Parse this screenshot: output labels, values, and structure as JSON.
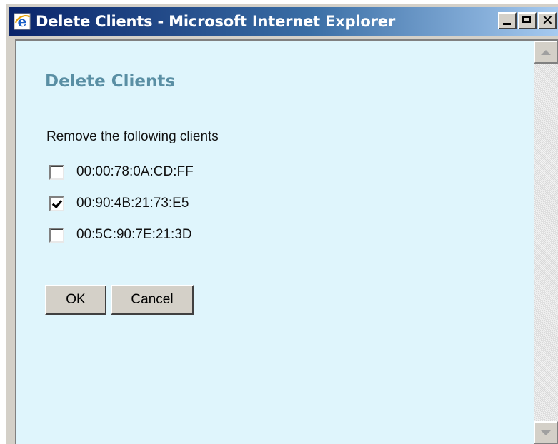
{
  "window": {
    "title": "Delete Clients - Microsoft Internet Explorer",
    "icon": "internet-explorer-icon",
    "controls": [
      "minimize",
      "maximize",
      "close"
    ]
  },
  "page": {
    "title": "Delete Clients",
    "title_color": "#5a8fa4",
    "background_color": "#dff5fc",
    "instruction": "Remove the following clients",
    "clients": [
      {
        "mac": "00:00:78:0A:CD:FF",
        "checked": false
      },
      {
        "mac": "00:90:4B:21:73:E5",
        "checked": true
      },
      {
        "mac": "00:5C:90:7E:21:3D",
        "checked": false
      }
    ],
    "buttons": {
      "ok_label": "OK",
      "cancel_label": "Cancel"
    }
  }
}
